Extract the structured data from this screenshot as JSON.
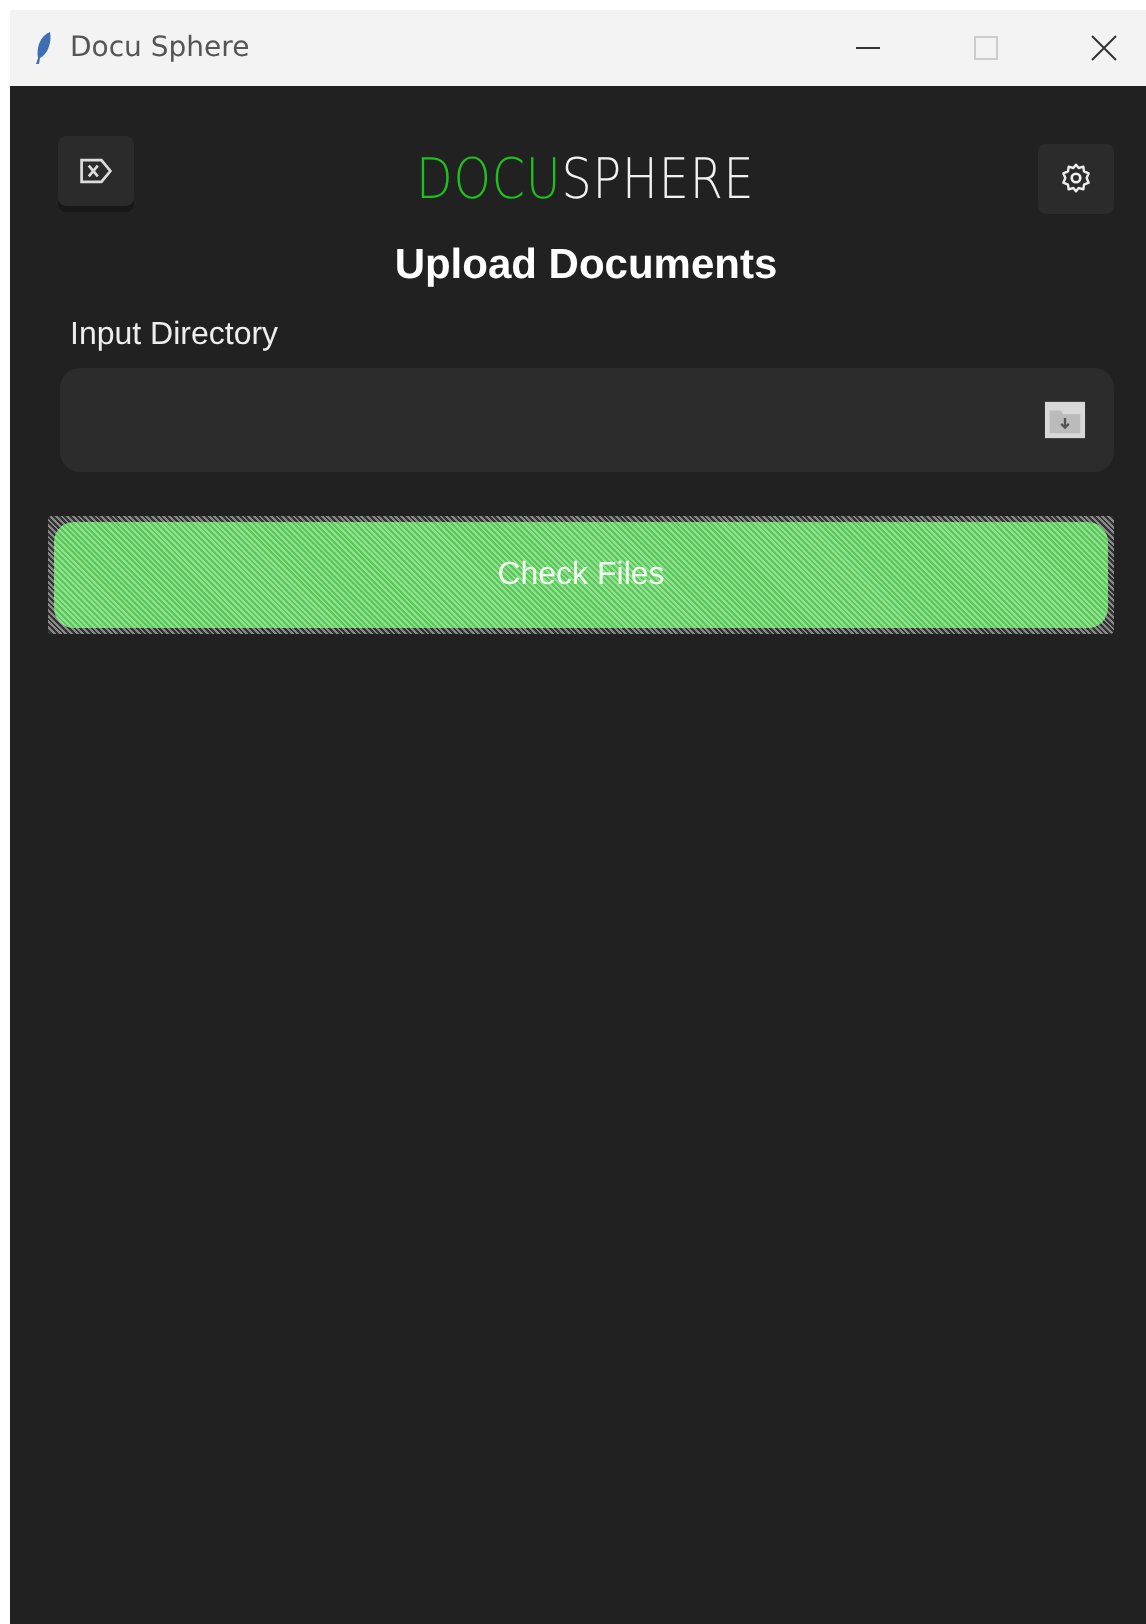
{
  "window": {
    "title": "Docu Sphere"
  },
  "logo": {
    "accent": "DOCU",
    "rest": "SPHERE"
  },
  "heading": "Upload Documents",
  "input_directory": {
    "label": "Input Directory"
  },
  "check_button": {
    "label": "Check Files",
    "disabled": true
  }
}
